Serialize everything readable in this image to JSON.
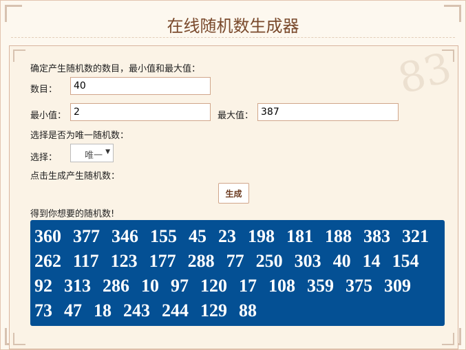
{
  "title": "在线随机数生成器",
  "form": {
    "intro": "确定产生随机数的数目，最小值和最大值：",
    "count_label": "数目：",
    "count_value": "40",
    "min_label": "最小值：",
    "min_value": "2",
    "max_label": "最大值：",
    "max_value": "387",
    "unique_prompt": "选择是否为唯一随机数：",
    "select_label": "选择：",
    "select_value": "唯一",
    "generate_prompt": "点击生成产生随机数：",
    "generate_button": "生成",
    "result_label": "得到你想要的随机数!"
  },
  "results": [
    360,
    377,
    346,
    155,
    45,
    23,
    198,
    181,
    188,
    383,
    321,
    262,
    117,
    123,
    177,
    288,
    77,
    250,
    303,
    40,
    14,
    154,
    92,
    313,
    286,
    10,
    97,
    120,
    17,
    108,
    359,
    375,
    309,
    73,
    47,
    18,
    243,
    244,
    129,
    88
  ],
  "colors": {
    "result_bg": "#045094",
    "title": "#7a4a2c",
    "border": "#d8b49e"
  }
}
